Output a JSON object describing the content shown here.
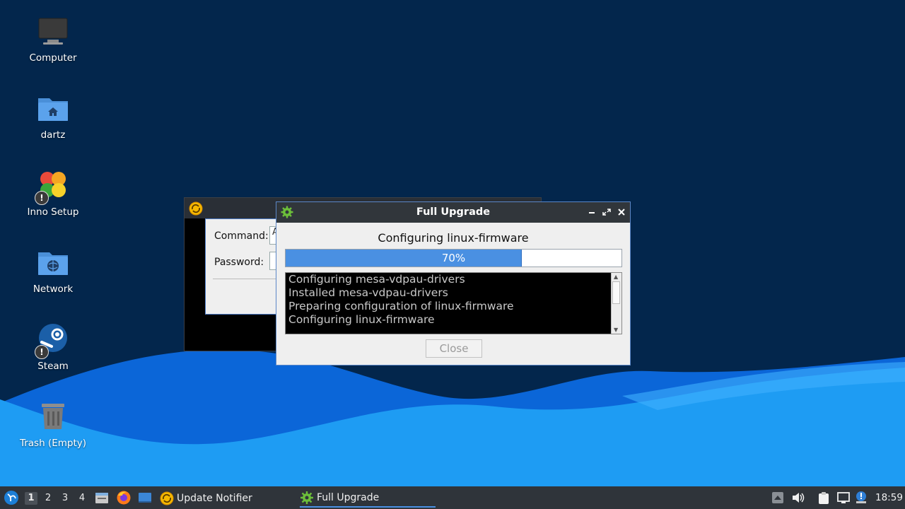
{
  "desktop": {
    "icons": [
      {
        "label": "Computer"
      },
      {
        "label": "dartz"
      },
      {
        "label": "Inno Setup"
      },
      {
        "label": "Network"
      },
      {
        "label": "Steam"
      },
      {
        "label": "Trash (Empty)"
      }
    ]
  },
  "background_window": {
    "command_label": "Command:",
    "password_label": "Password:",
    "command_value": "A"
  },
  "dialog": {
    "title": "Full Upgrade",
    "status": "Configuring linux-firmware",
    "progress_percent": 70,
    "progress_label": "70%",
    "log_lines": [
      "Configuring mesa-vdpau-drivers",
      "Installed mesa-vdpau-drivers",
      "Preparing configuration of linux-firmware",
      "Configuring linux-firmware"
    ],
    "close_label": "Close",
    "buttons": [
      "minimize-icon",
      "maximize-icon",
      "close-icon"
    ]
  },
  "taskbar": {
    "workspaces": [
      "1",
      "2",
      "3",
      "4"
    ],
    "active_workspace": "1",
    "tasks": [
      {
        "label": "Update Notifier",
        "icon": "update-notifier-icon"
      },
      {
        "label": "Full Upgrade",
        "icon": "gear-icon"
      }
    ],
    "tray_icons": [
      "arrow-up-icon",
      "volume-icon",
      "clipboard-icon",
      "network-icon",
      "notification-icon"
    ],
    "clock": "18:59"
  },
  "colors": {
    "desktop_bg": "#03264c",
    "wave_light": "#1e9cf3",
    "wave_dark": "#0b66d8",
    "titlebar": "#31363b",
    "progress_fill": "#4a90e2",
    "taskbar": "#2f343a"
  }
}
